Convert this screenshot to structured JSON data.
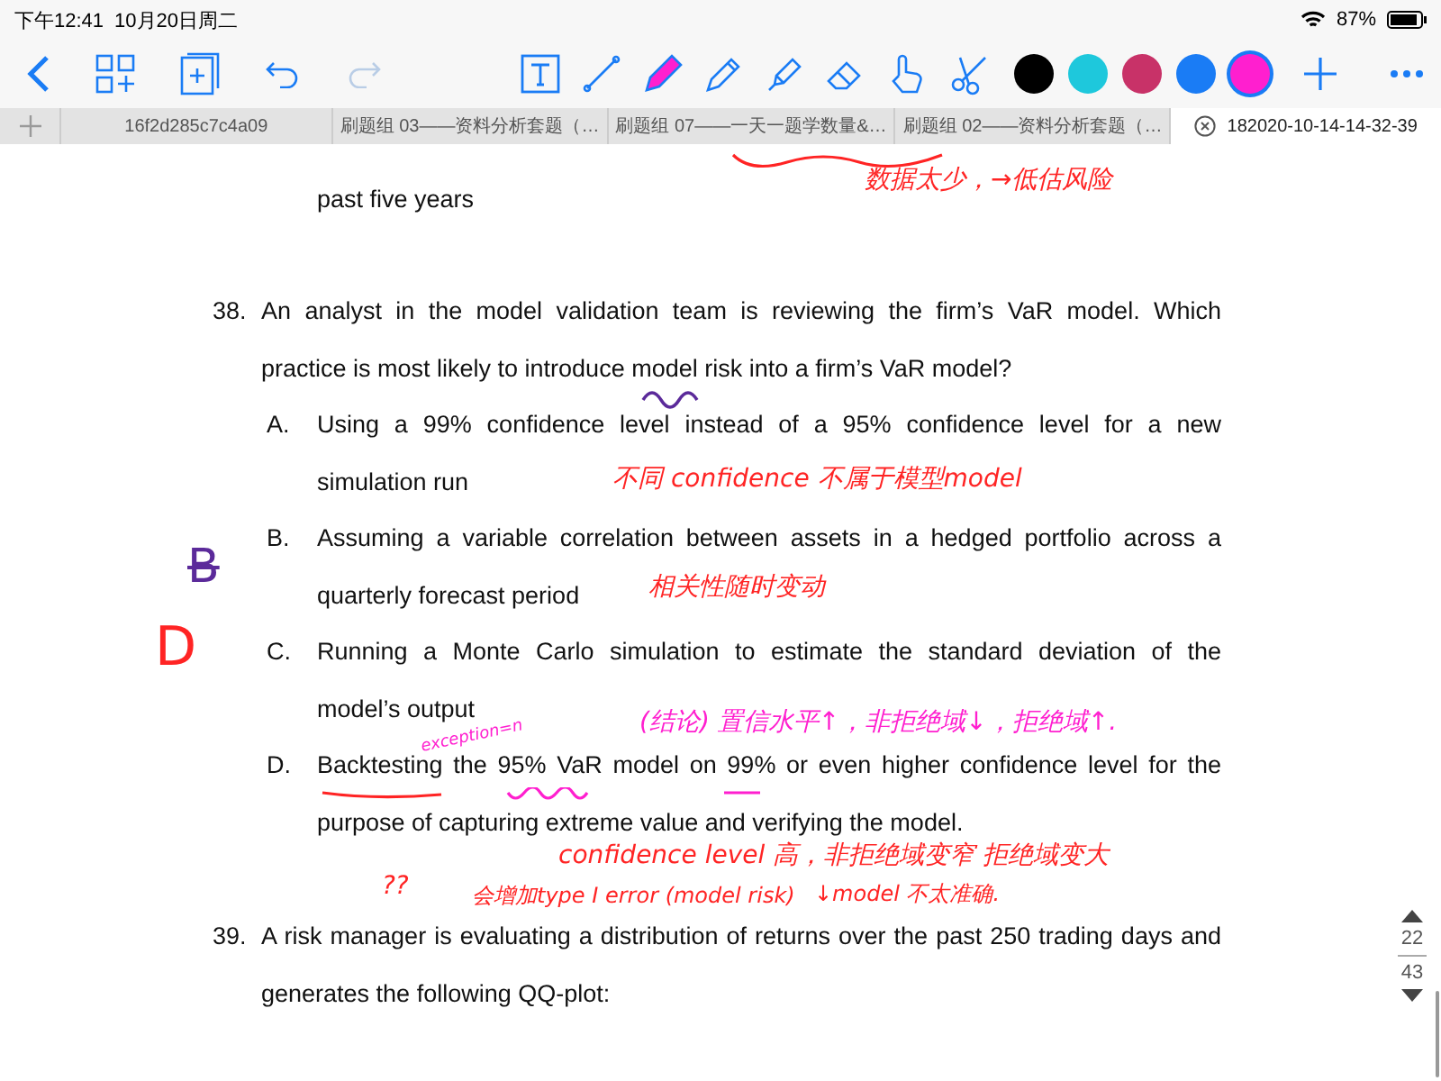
{
  "status_bar": {
    "time": "下午12:41",
    "date": "10月20日周二",
    "battery": "87%"
  },
  "toolbar": {
    "tools": [
      {
        "kind": "text",
        "selected": false
      },
      {
        "kind": "line",
        "selected": false
      },
      {
        "kind": "pen",
        "selected": true
      },
      {
        "kind": "pencil",
        "selected": false
      },
      {
        "kind": "highlighter",
        "selected": false
      },
      {
        "kind": "eraser",
        "selected": false
      },
      {
        "kind": "finger",
        "selected": false
      },
      {
        "kind": "scissors",
        "selected": false
      }
    ],
    "colors": [
      {
        "color": "#000000",
        "selected": false
      },
      {
        "color": "#1ec8dc",
        "selected": false
      },
      {
        "color": "#c83268",
        "selected": false
      },
      {
        "color": "#1a7cf5",
        "selected": false
      },
      {
        "color": "#ff1fcf",
        "selected": true
      }
    ]
  },
  "tabs": [
    {
      "label": "16f2d285c7c4a09",
      "selected": false
    },
    {
      "label": "刷题组 03——资料分析套题（…",
      "selected": false
    },
    {
      "label": "刷题组 07——一天一题学数量&…",
      "selected": false
    },
    {
      "label": "刷题组 02——资料分析套题（…",
      "selected": false
    },
    {
      "label": "182020-10-14-14-32-39",
      "selected": true
    }
  ],
  "page": {
    "continuation": "past five years",
    "questions": [
      {
        "number": "38.",
        "lines": [
          "An analyst in the model validation team is reviewing the firm’s VaR model. Which",
          "practice is most likely to introduce model risk into a firm’s VaR model?"
        ],
        "options": [
          {
            "letter": "A.",
            "lines": [
              "Using a 99% confidence level instead of a 95% confidence level for a new",
              "simulation run"
            ]
          },
          {
            "letter": "B.",
            "lines": [
              "Assuming a variable correlation between assets in a hedged portfolio across a",
              "quarterly forecast period"
            ]
          },
          {
            "letter": "C.",
            "lines": [
              "Running a Monte Carlo simulation to estimate the standard deviation of the",
              "model’s output"
            ]
          },
          {
            "letter": "D.",
            "lines": [
              "Backtesting the 95% VaR model on 99% or even higher confidence level for the",
              "purpose of capturing extreme value and verifying the model."
            ]
          }
        ]
      },
      {
        "number": "39.",
        "lines": [
          "A risk manager is evaluating a distribution of returns over the past 250 trading days and",
          "generates the following QQ-plot:"
        ]
      }
    ]
  },
  "annotations": [
    {
      "kind": "note",
      "text": "数据太少，→低估风险",
      "color": "#ff2424"
    },
    {
      "kind": "note",
      "text": "不同 confidence 不属于模型model",
      "color": "#ff2424"
    },
    {
      "kind": "note",
      "text": "相关性随时变动",
      "color": "#ff2424"
    },
    {
      "kind": "crossed",
      "text": "B",
      "color": "#5b2a9a"
    },
    {
      "kind": "big",
      "text": "D",
      "color": "#ff2424"
    },
    {
      "kind": "tiny",
      "text": "exception=n",
      "color": "#ff1fcf"
    },
    {
      "kind": "note",
      "text": "(结论) 置信水平↑，非拒绝域↓，拒绝域↑.",
      "color": "#ff1fcf"
    },
    {
      "kind": "note",
      "text": "confidence level 高，非拒绝域变窄 拒绝域变大",
      "color": "#ff2424"
    },
    {
      "kind": "note",
      "text": "??",
      "color": "#ff2424"
    },
    {
      "kind": "small",
      "text": "会增加type I error (model risk)",
      "color": "#ff2424"
    },
    {
      "kind": "small",
      "text": "↓model 不太准确.",
      "color": "#ff2424"
    }
  ],
  "page_indicator": {
    "current": "22",
    "total": "43"
  }
}
